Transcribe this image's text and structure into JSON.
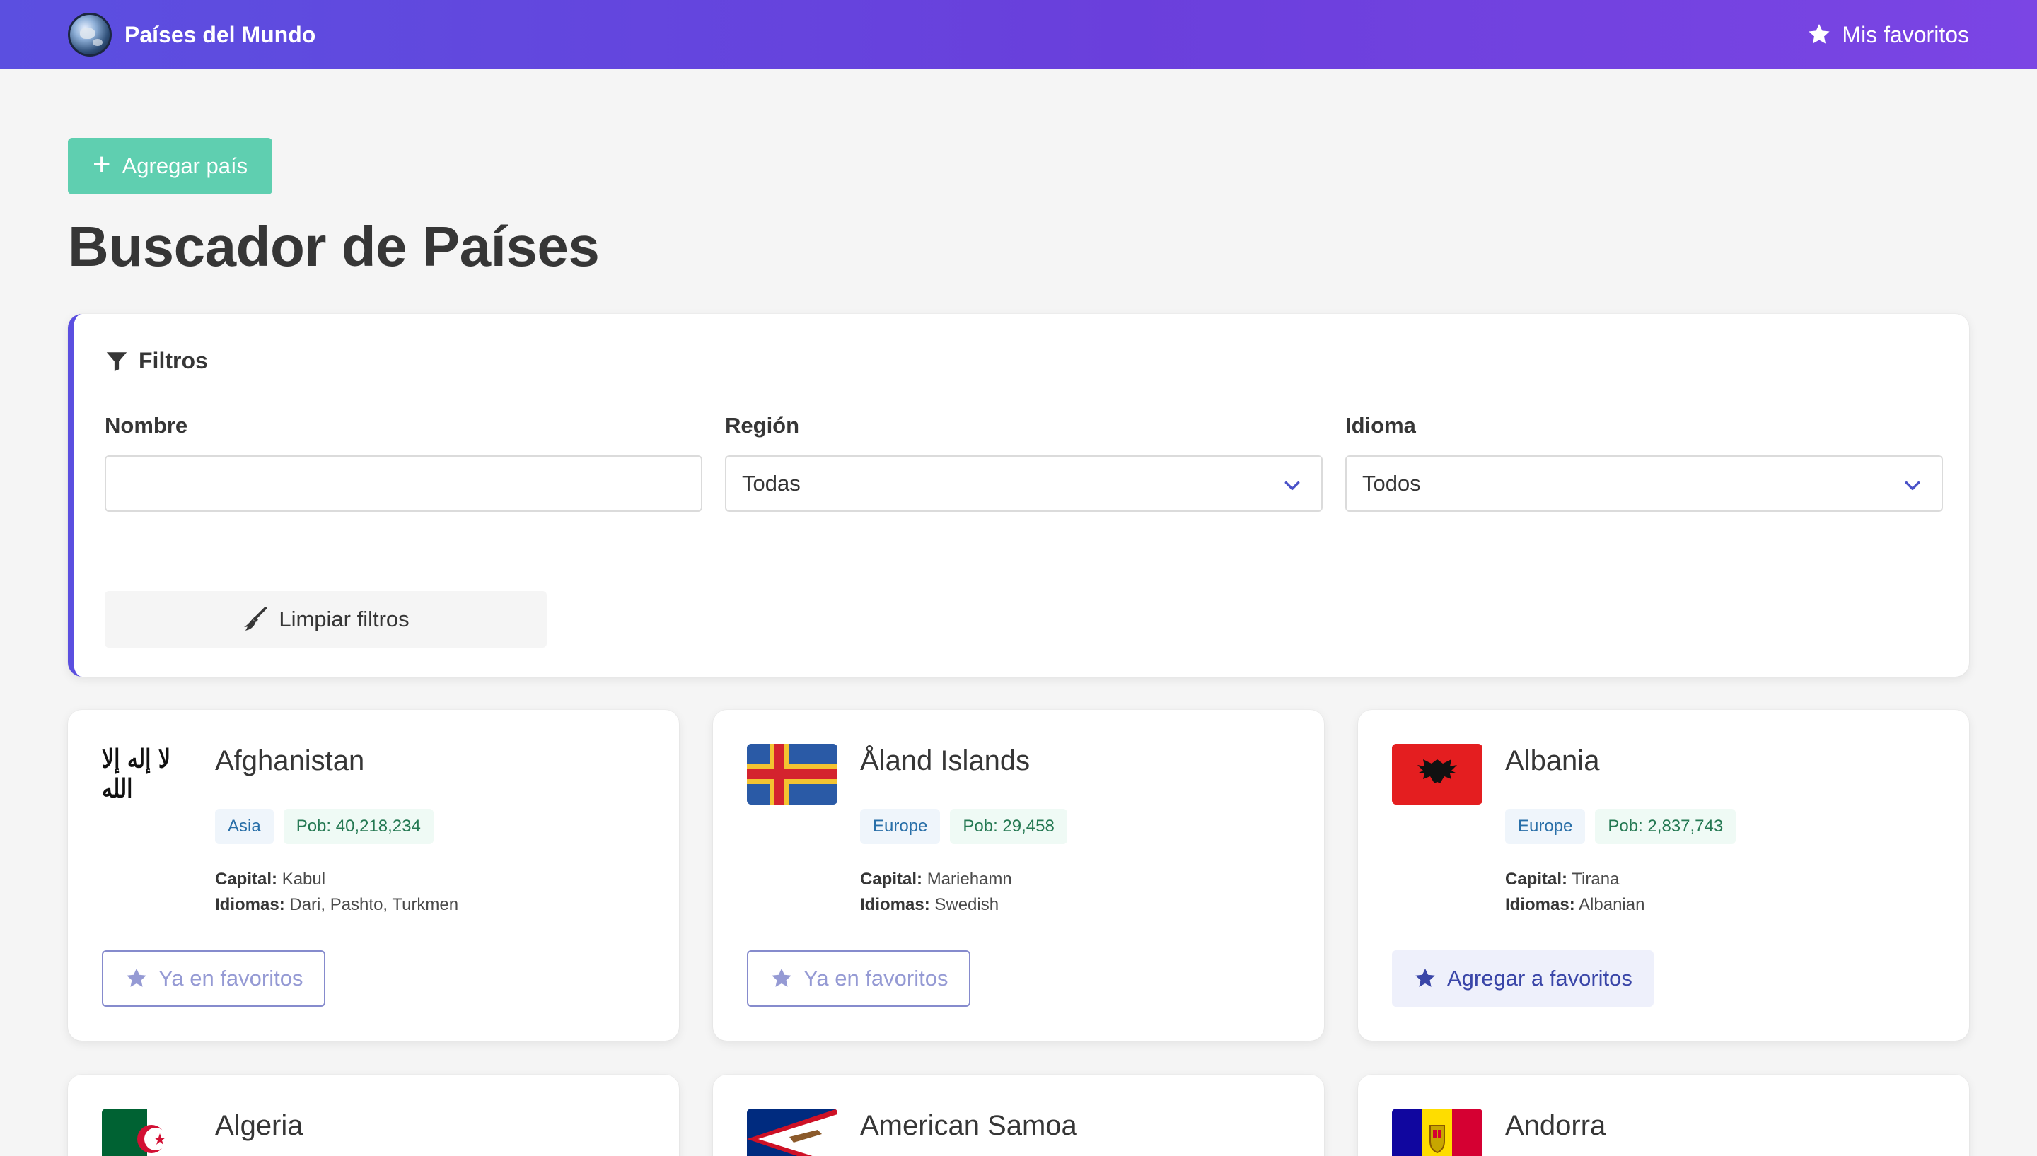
{
  "navbar": {
    "brand": "Países del Mundo",
    "favorites_link": "Mis favoritos"
  },
  "main": {
    "add_button": "Agregar país",
    "title": "Buscador de Países"
  },
  "filters": {
    "heading": "Filtros",
    "name_label": "Nombre",
    "name_value": "",
    "region_label": "Región",
    "region_value": "Todas",
    "language_label": "Idioma",
    "language_value": "Todos",
    "clear_button": "Limpiar filtros"
  },
  "labels": {
    "capital": "Capital:",
    "languages": "Idiomas:"
  },
  "countries": [
    {
      "name": "Afghanistan",
      "region": "Asia",
      "population": "Pob: 40,218,234",
      "capital": "Kabul",
      "languages": "Dari, Pashto, Turkmen",
      "flag_text": "لا إله إلا الله",
      "favorite_button": "Ya en favoritos",
      "favorite_state": "disabled"
    },
    {
      "name": "Åland Islands",
      "region": "Europe",
      "population": "Pob: 29,458",
      "capital": "Mariehamn",
      "languages": "Swedish",
      "favorite_button": "Ya en favoritos",
      "favorite_state": "disabled"
    },
    {
      "name": "Albania",
      "region": "Europe",
      "population": "Pob: 2,837,743",
      "capital": "Tirana",
      "languages": "Albanian",
      "favorite_button": "Agregar a favoritos",
      "favorite_state": "active"
    },
    {
      "name": "Algeria"
    },
    {
      "name": "American Samoa"
    },
    {
      "name": "Andorra"
    }
  ],
  "colors": {
    "primary": "#5b4fe0",
    "success": "#5fcfb0",
    "background": "#f5f5f5"
  },
  "icons": [
    "globe-icon",
    "star-icon",
    "plus-icon",
    "filter-icon",
    "chevron-down-icon",
    "broom-icon"
  ]
}
